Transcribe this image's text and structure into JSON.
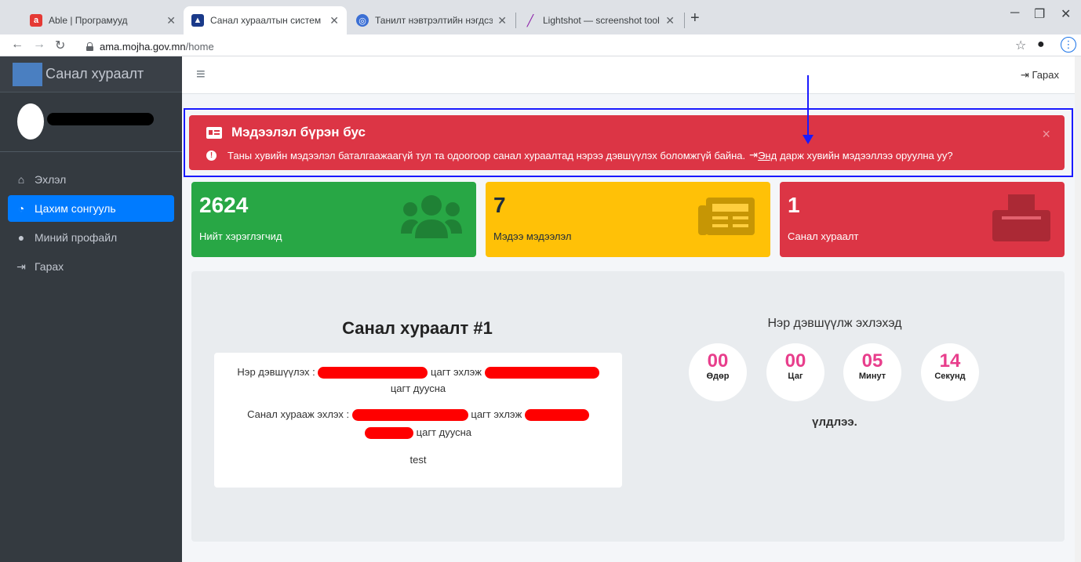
{
  "browser": {
    "tabs": [
      {
        "title": "Able | Програмууд",
        "active": false
      },
      {
        "title": "Санал хураалтын систем",
        "active": true
      },
      {
        "title": "Танилт нэвтрэлтийн нэгдсэн сис",
        "active": false
      },
      {
        "title": "Lightshot — screenshot tool for",
        "active": false
      }
    ],
    "new_tab": "+",
    "url_host": "ama.mojha.gov.mn",
    "url_path": "/home"
  },
  "sidebar": {
    "brand": "Санал хураалт",
    "menu": [
      {
        "label": "Эхлэл",
        "icon": "home-icon",
        "active": false
      },
      {
        "label": "Цахим сонгууль",
        "icon": "dashboard-icon",
        "active": true
      },
      {
        "label": "Миний профайл",
        "icon": "user-icon",
        "active": false
      },
      {
        "label": "Гарах",
        "icon": "logout-icon",
        "active": false
      }
    ]
  },
  "navbar": {
    "logout": "Гарах"
  },
  "alert": {
    "title": "Мэдээлэл бүрэн бус",
    "message": "Таны хувийн мэдээлэл баталгаажаагүй тул та одоогоор санал хураалтад нэрээ дэвшүүлэх боломжгүй байна.",
    "link_text": "Энд",
    "link_suffix": "дарж хувийн мэдээллээ оруулна уу?",
    "close": "×"
  },
  "stats": [
    {
      "value": "2624",
      "label": "Нийт хэрэглэгчид",
      "color": "#28a745",
      "icon": "users-icon"
    },
    {
      "value": "7",
      "label": "Мэдээ мэдээлэл",
      "color": "#ffc107",
      "icon": "newspaper-icon"
    },
    {
      "value": "1",
      "label": "Санал хураалт",
      "color": "#dc3545",
      "icon": "ballot-icon"
    }
  ],
  "poll": {
    "title": "Санал хураалт #1",
    "nomination_label": "Нэр дэвшүүлэх :",
    "start_suffix": "цагт эхлэж",
    "end_suffix": "цагт дуусна",
    "voting_label": "Санал хурааж эхлэх :",
    "description": "test"
  },
  "countdown": {
    "title": "Нэр дэвшүүлж эхлэхэд",
    "units": [
      {
        "value": "00",
        "label": "Өдөр"
      },
      {
        "value": "00",
        "label": "Цаг"
      },
      {
        "value": "05",
        "label": "Минут"
      },
      {
        "value": "14",
        "label": "Секунд"
      }
    ],
    "remaining": "үлдлээ."
  }
}
